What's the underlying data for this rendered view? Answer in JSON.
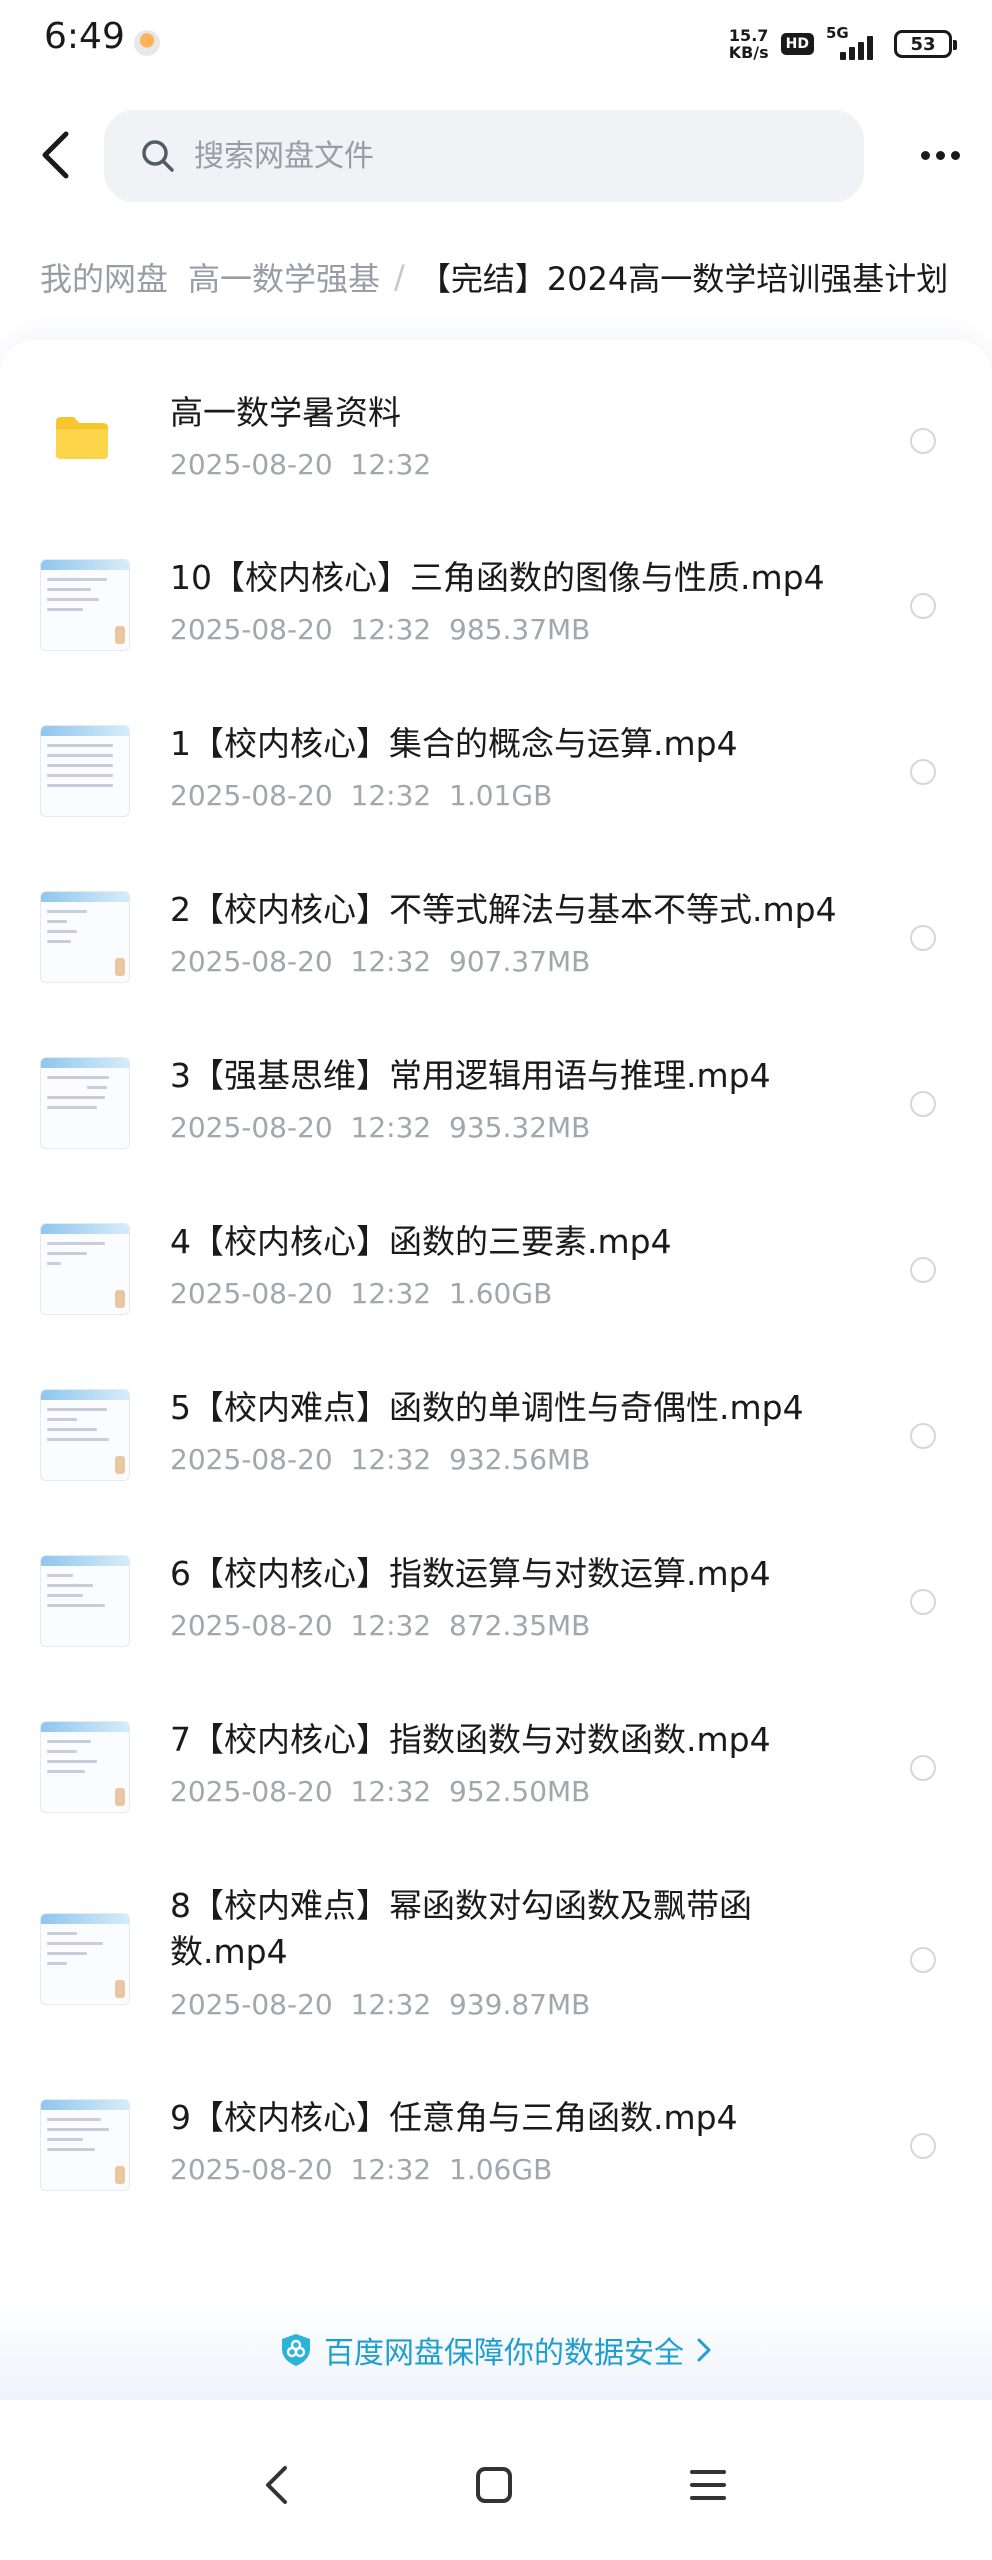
{
  "status_bar": {
    "time": "6:49",
    "net_speed_value": "15.7",
    "net_speed_unit": "KB/s",
    "hd_badge": "HD",
    "network_type": "5G",
    "battery_level": "53"
  },
  "search": {
    "placeholder": "搜索网盘文件"
  },
  "breadcrumb": {
    "root": "我的网盘",
    "parent": "高一数学强基",
    "separator": "/",
    "current": "【完结】2024高一数学培训强基计划"
  },
  "files": [
    {
      "name": "高一数学暑资料",
      "date": "2025-08-20  12:32",
      "size": "",
      "type": "folder"
    },
    {
      "name": "10【校内核心】三角函数的图像与性质.mp4",
      "date": "2025-08-20  12:32",
      "size": "985.37MB",
      "type": "video"
    },
    {
      "name": "1【校内核心】集合的概念与运算.mp4",
      "date": "2025-08-20  12:32",
      "size": "1.01GB",
      "type": "video"
    },
    {
      "name": "2【校内核心】不等式解法与基本不等式.mp4",
      "date": "2025-08-20  12:32",
      "size": "907.37MB",
      "type": "video"
    },
    {
      "name": "3【强基思维】常用逻辑用语与推理.mp4",
      "date": "2025-08-20  12:32",
      "size": "935.32MB",
      "type": "video"
    },
    {
      "name": "4【校内核心】函数的三要素.mp4",
      "date": "2025-08-20  12:32",
      "size": "1.60GB",
      "type": "video"
    },
    {
      "name": "5【校内难点】函数的单调性与奇偶性.mp4",
      "date": "2025-08-20  12:32",
      "size": "932.56MB",
      "type": "video"
    },
    {
      "name": "6【校内核心】指数运算与对数运算.mp4",
      "date": "2025-08-20  12:32",
      "size": "872.35MB",
      "type": "video"
    },
    {
      "name": "7【校内核心】指数函数与对数函数.mp4",
      "date": "2025-08-20  12:32",
      "size": "952.50MB",
      "type": "video"
    },
    {
      "name": "8【校内难点】幂函数对勾函数及飘带函数.mp4",
      "date": "2025-08-20  12:32",
      "size": "939.87MB",
      "type": "video"
    },
    {
      "name": "9【校内核心】任意角与三角函数.mp4",
      "date": "2025-08-20  12:32",
      "size": "1.06GB",
      "type": "video"
    }
  ],
  "footer": {
    "security_text": "百度网盘保障你的数据安全",
    "accent_color": "#1f9fcf"
  },
  "icons": {
    "back": "back-arrow-icon",
    "search": "search-icon",
    "more": "more-dots-icon",
    "folder": "folder-icon",
    "shield": "shield-icon",
    "nav_back": "nav-back-icon",
    "nav_home": "nav-home-icon",
    "nav_menu": "nav-menu-icon"
  }
}
